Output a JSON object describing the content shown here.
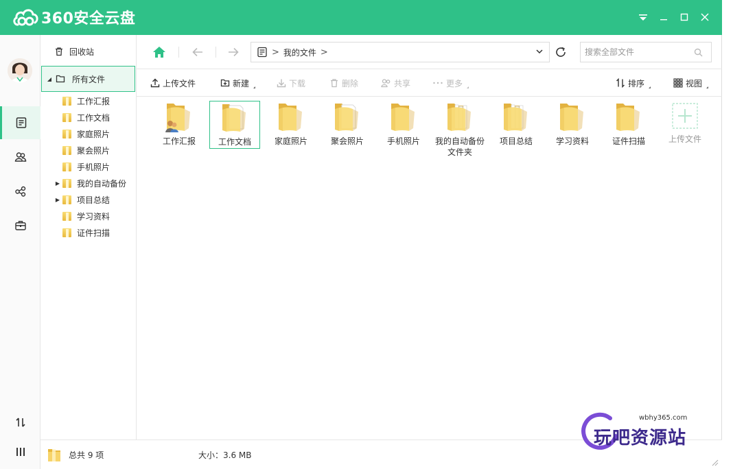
{
  "app": {
    "title": "360安全云盘",
    "accent": "#2fc188"
  },
  "window_controls": [
    "menu-icon",
    "minimize-icon",
    "maximize-icon",
    "close-icon"
  ],
  "leftbar": {
    "items": [
      {
        "name": "files",
        "icon": "document-icon",
        "active": true
      },
      {
        "name": "contacts",
        "icon": "users-icon",
        "active": false
      },
      {
        "name": "share",
        "icon": "share-icon",
        "active": false
      },
      {
        "name": "toolbox",
        "icon": "toolbox-icon",
        "active": false
      }
    ],
    "bottom": [
      "transfer-icon",
      "menu-bars-icon"
    ]
  },
  "tree": {
    "recycle_label": "回收站",
    "all_files_label": "所有文件",
    "children": [
      {
        "label": "工作汇报",
        "expandable": false
      },
      {
        "label": "工作文档",
        "expandable": false
      },
      {
        "label": "家庭照片",
        "expandable": false
      },
      {
        "label": "聚会照片",
        "expandable": false
      },
      {
        "label": "手机照片",
        "expandable": false
      },
      {
        "label": "我的自动备份",
        "expandable": true
      },
      {
        "label": "项目总结",
        "expandable": true
      },
      {
        "label": "学习资料",
        "expandable": false
      },
      {
        "label": "证件扫描",
        "expandable": false
      }
    ]
  },
  "nav": {
    "path_label": "我的文件",
    "search_placeholder": "搜索全部文件"
  },
  "toolbar": {
    "upload": "上传文件",
    "new": "新建",
    "download": "下载",
    "delete": "删除",
    "share": "共享",
    "more": "更多",
    "sort": "排序",
    "view": "视图"
  },
  "files": [
    {
      "label": "工作汇报",
      "variant": "shared"
    },
    {
      "label": "工作文档",
      "variant": "doc",
      "selected": true
    },
    {
      "label": "家庭照片",
      "variant": "plain"
    },
    {
      "label": "聚会照片",
      "variant": "doc"
    },
    {
      "label": "手机照片",
      "variant": "plain"
    },
    {
      "label": "我的自动备份文件夹",
      "variant": "files"
    },
    {
      "label": "项目总结",
      "variant": "files"
    },
    {
      "label": "学习资料",
      "variant": "plain"
    },
    {
      "label": "证件扫描",
      "variant": "plain"
    }
  ],
  "upload_tile_label": "上传文件",
  "status": {
    "total": "总共 9 项",
    "size": "大小：3.6 MB"
  },
  "watermark": {
    "url": "wbhy365.com",
    "text": "玩吧资源站"
  }
}
